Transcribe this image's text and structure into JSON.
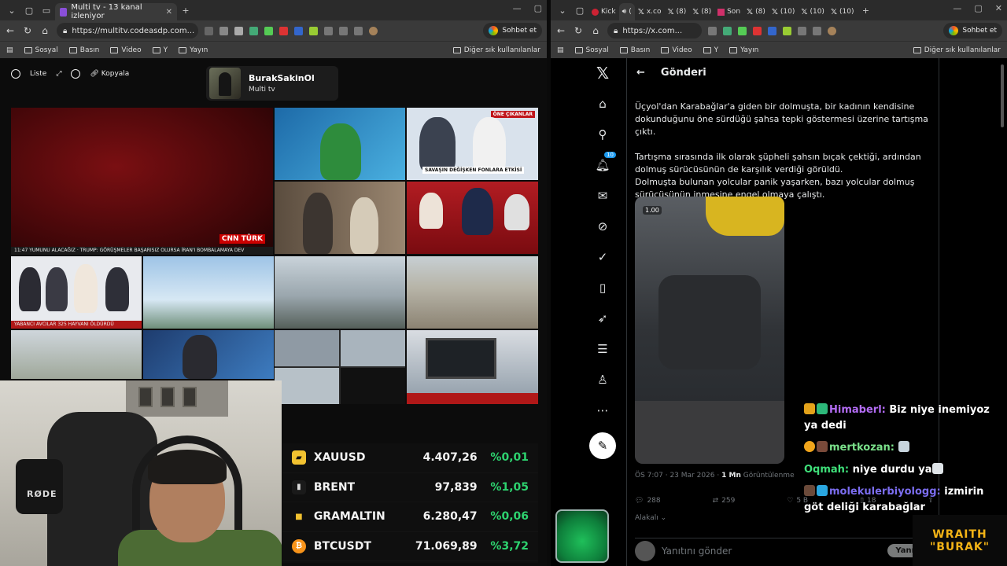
{
  "left_browser": {
    "tab_title": "Multi tv - 13 kanal izleniyor",
    "url": "https://multitv.codeasdp.com...",
    "copilot_label": "Sohbet et",
    "bookmarks": [
      "Sosyal",
      "Basın",
      "Video",
      "Y",
      "Yayın"
    ],
    "bookmarks_other": "Diğer sık kullanılanlar"
  },
  "right_browser": {
    "tabs": [
      "Kick",
      "x.co",
      "(8)",
      "(8)",
      "Son",
      "(8)",
      "(10)",
      "(10)",
      "(10)"
    ],
    "url": "https://x.com...",
    "copilot_label": "Sohbet et",
    "bookmarks": [
      "Sosyal",
      "Basın",
      "Video",
      "Y",
      "Yayın"
    ],
    "bookmarks_other": "Diğer sık kullanılanlar"
  },
  "multitv": {
    "toolbar": {
      "list_label": "Liste",
      "copy_label": "Kopyala"
    },
    "channel": {
      "name": "BurakSakinOl",
      "subtitle": "Multi tv"
    },
    "tickers": {
      "cnn": "11:47  YUMUNU ALACAĞIZ · TRUMP: GÖRÜŞMELER BAŞARISIZ OLURSA İRAN'I BOMBALAMAYA DEV",
      "cnn_logo": "CNN TÜRK",
      "tile3": "SAVAŞIN DEĞİŞKEN FONLARA ETKİSİ",
      "tile3_top": "ÖNE ÇIKANLAR",
      "tile5": "YABANCI AVCILAR 325 HAYVANI ÖLDÜRDÜ"
    }
  },
  "prices": [
    {
      "symbol": "XAUUSD",
      "value": "4.407,26",
      "change": "%0,01",
      "icon_color": "#f2c230"
    },
    {
      "symbol": "BRENT",
      "value": "97,839",
      "change": "%1,05",
      "icon_color": "#d9d9d9"
    },
    {
      "symbol": "GRAMALTIN",
      "value": "6.280,47",
      "change": "%0,06",
      "icon_color": "#f2c230"
    },
    {
      "symbol": "BTCUSDT",
      "value": "71.069,89",
      "change": "%3,72",
      "icon_color": "#f7931a"
    }
  ],
  "webcam": {
    "mic_brand": "RØDE"
  },
  "x_post": {
    "header": "Gönderi",
    "notification_count": "10",
    "paragraphs": [
      "Üçyol'dan Karabağlar'a giden bir dolmuşta, bir kadının kendisine dokunduğunu öne sürdüğü şahsa tepki göstermesi üzerine tartışma çıktı.",
      "Tartışma sırasında ilk olarak şüpheli şahsın bıçak çektiği, ardından dolmuş sürücüsünün de karşılık verdiği görüldü.",
      "Dolmuşta bulunan yolcular panik yaşarken, bazı yolcular dolmuş sürücüsünün inmesine engel olmaya çalıştı."
    ],
    "media_speed": "1.00",
    "time": "ÖS 7:07 · 23 Mar 2026 · ",
    "views_count": "1 Mn",
    "views_label": "Görüntülenme",
    "replies": "288",
    "reposts": "259",
    "likes": "5 B",
    "bookmarks": "18",
    "sort_label": "Alakalı",
    "reply_placeholder": "Yanıtını gönder",
    "reply_button": "Yanıtla"
  },
  "chat": [
    {
      "user": "Himaberl:",
      "text": "Biz niye inemiyoz ya dedi"
    },
    {
      "user": "mertkozan:",
      "text": ""
    },
    {
      "user": "Oqmah:",
      "text": "niye durdu ya"
    },
    {
      "user": "molekulerbiyologg:",
      "text": "izmirin göt deliği karabağlar"
    }
  ],
  "brand": {
    "line1": "WRAITH",
    "line2": "\"BURAK\""
  }
}
